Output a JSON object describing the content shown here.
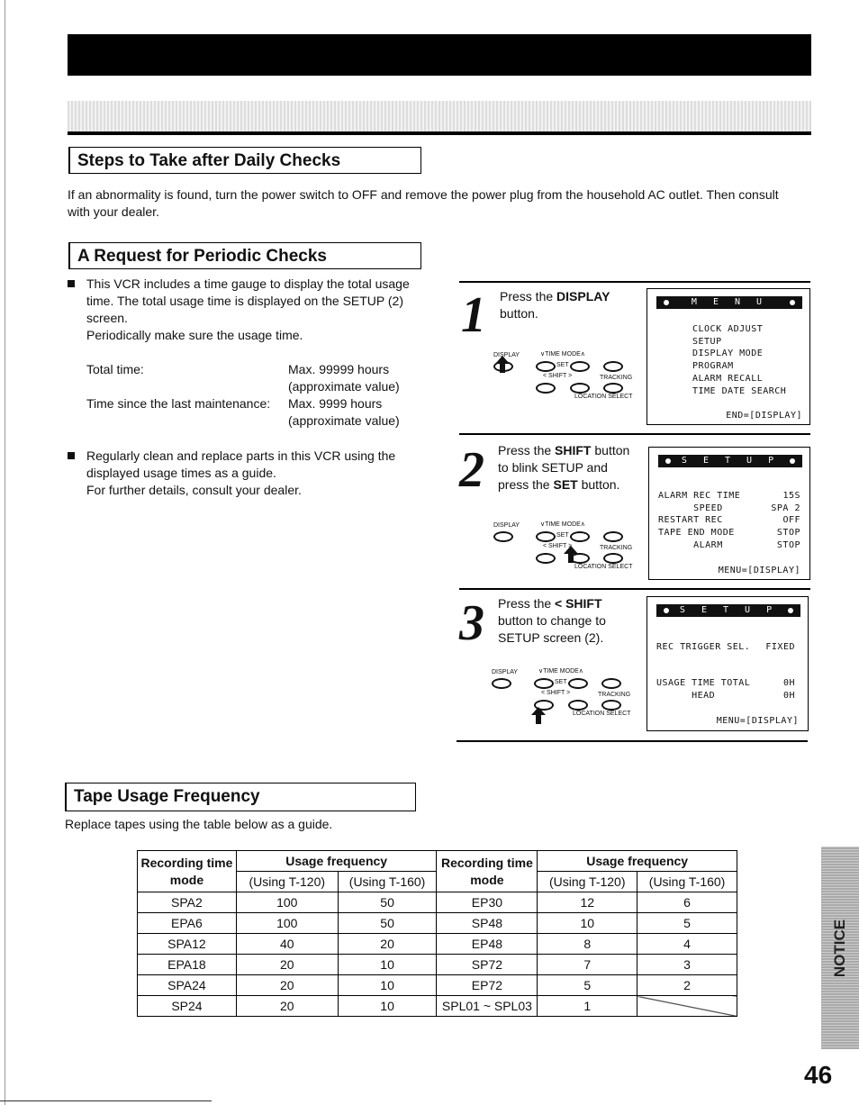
{
  "steps_section": {
    "title": "Steps to Take after Daily Checks",
    "text": "If an abnormality is found, turn the power switch to OFF and remove the power plug from the household AC outlet. Then consult with your dealer."
  },
  "periodic": {
    "title": "A Request for Periodic Checks",
    "bullet1": "This VCR includes a time gauge to display the total usage time. The total usage time is displayed on the SETUP (2) screen.",
    "bullet1_note": "Periodically make sure the usage time.",
    "gauge": [
      {
        "label": "Total time:",
        "value": "Max. 99999 hours",
        "note": "(approximate value)"
      },
      {
        "label": "Time since the last maintenance:",
        "value": "Max. 9999 hours",
        "note": "(approximate value)"
      }
    ],
    "bullet2": "Regularly clean and replace parts in this VCR using the displayed usage times as a guide.",
    "bullet2_note": "For further details, consult your dealer."
  },
  "remote_labels": {
    "display": "DISPLAY",
    "time_mode": "∨TIME MODE∧",
    "set": "SET",
    "shift": "<  SHIFT  >",
    "tracking": "TRACKING",
    "location": "LOCATION SELECT"
  },
  "procedure": [
    {
      "number": "1",
      "pre": "Press the ",
      "bold": "DISPLAY",
      "post": " button.",
      "screen": {
        "title": "M E N U",
        "lines": [
          "CLOCK ADJUST",
          "SETUP",
          "DISPLAY MODE",
          "PROGRAM",
          "ALARM RECALL",
          "TIME DATE SEARCH"
        ],
        "footer": "END=[DISPLAY]"
      }
    },
    {
      "number": "2",
      "pre": "Press the ",
      "bold": "SHIFT",
      "post": " button to blink SETUP and press the ",
      "bold2": "SET",
      "post2": " button.",
      "screen": {
        "title": "S E T U P",
        "rows": [
          [
            "ALARM REC TIME",
            "15S"
          ],
          [
            "      SPEED",
            "SPA 2"
          ],
          [
            "RESTART REC",
            "OFF"
          ],
          [
            "TAPE END MODE",
            "STOP"
          ],
          [
            "      ALARM",
            "STOP"
          ]
        ],
        "footer": "MENU=[DISPLAY]"
      }
    },
    {
      "number": "3",
      "pre": "Press the ",
      "bold": "< SHIFT",
      "post": " button to change to SETUP screen (2).",
      "screen": {
        "title": "S E T U P",
        "rows": [
          [
            "REC TRIGGER SEL.",
            "FIXED"
          ],
          [
            "USAGE TIME TOTAL",
            "0H"
          ],
          [
            "      HEAD",
            "0H"
          ]
        ],
        "footer": "MENU=[DISPLAY]"
      }
    }
  ],
  "tape": {
    "title": "Tape Usage Frequency",
    "text": "Replace tapes using the table below as a guide.",
    "headers": {
      "mode": "Recording time mode",
      "usage": "Usage frequency",
      "t120": "(Using T-120)",
      "t160": "(Using T-160)"
    },
    "left_rows": [
      [
        "SPA2",
        "100",
        "50"
      ],
      [
        "EPA6",
        "100",
        "50"
      ],
      [
        "SPA12",
        "40",
        "20"
      ],
      [
        "EPA18",
        "20",
        "10"
      ],
      [
        "SPA24",
        "20",
        "10"
      ],
      [
        "SP24",
        "20",
        "10"
      ]
    ],
    "right_rows": [
      [
        "EP30",
        "12",
        "6"
      ],
      [
        "SP48",
        "10",
        "5"
      ],
      [
        "EP48",
        "8",
        "4"
      ],
      [
        "SP72",
        "7",
        "3"
      ],
      [
        "EP72",
        "5",
        "2"
      ],
      [
        "SPL01 ~ SPL03",
        "1",
        ""
      ]
    ]
  },
  "side_tab": "NOTICE",
  "page_number": "46"
}
